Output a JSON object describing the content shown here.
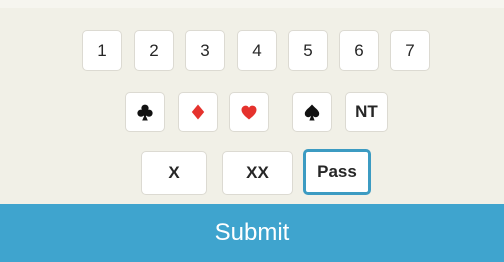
{
  "levels": [
    "1",
    "2",
    "3",
    "4",
    "5",
    "6",
    "7"
  ],
  "strains": {
    "clubs": "clubs-icon",
    "diamonds": "diamonds-icon",
    "hearts": "hearts-icon",
    "spades": "spades-icon",
    "notrump_label": "NT"
  },
  "calls": {
    "double_label": "X",
    "redouble_label": "XX",
    "pass_label": "Pass",
    "selected": "Pass"
  },
  "submit_label": "Submit",
  "colors": {
    "accent": "#3fa4ce",
    "selected_border": "#3c9bc2",
    "red_suit": "#e5322d",
    "black_suit": "#111111"
  }
}
